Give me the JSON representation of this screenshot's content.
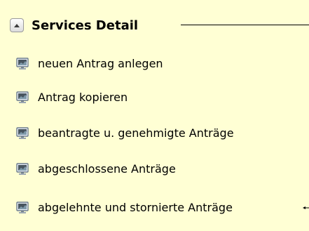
{
  "panel": {
    "title": "Services Detail",
    "collapse_icon": "triangle-up-icon",
    "item_icon": "monitor-icon",
    "items": [
      {
        "label": "neuen Antrag anlegen"
      },
      {
        "label": "Antrag kopieren"
      },
      {
        "label": "beantragte u. genehmigte Anträge"
      },
      {
        "label": "abgeschlossene Anträge"
      },
      {
        "label": "abgelehnte und stornierte Anträge"
      }
    ]
  },
  "colors": {
    "background": "#ffffd4",
    "text": "#000000"
  }
}
